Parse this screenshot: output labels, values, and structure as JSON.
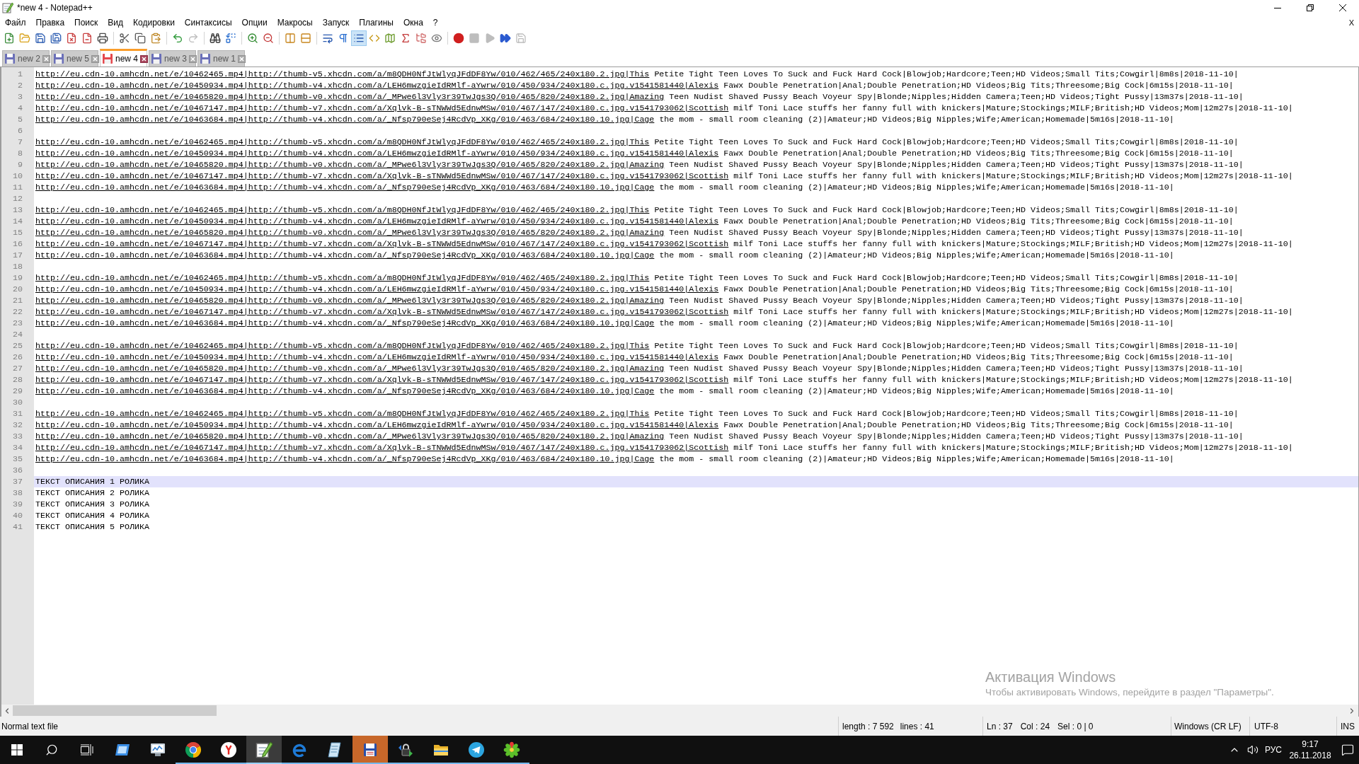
{
  "window": {
    "title": "*new 4 - Notepad++"
  },
  "menu": {
    "items": [
      "Файл",
      "Правка",
      "Поиск",
      "Вид",
      "Кодировки",
      "Синтаксисы",
      "Опции",
      "Макросы",
      "Запуск",
      "Плагины",
      "Окна",
      "?"
    ],
    "close": "X"
  },
  "toolbar": [
    {
      "kind": "new",
      "disabled": false,
      "pressed": false
    },
    {
      "kind": "open",
      "disabled": false,
      "pressed": false
    },
    {
      "kind": "save",
      "disabled": false,
      "pressed": false
    },
    {
      "kind": "save_all",
      "disabled": false,
      "pressed": false
    },
    {
      "kind": "close",
      "disabled": false,
      "pressed": false
    },
    {
      "kind": "close_all",
      "disabled": false,
      "pressed": false
    },
    {
      "kind": "print",
      "disabled": false,
      "pressed": false
    },
    {
      "kind": "separator"
    },
    {
      "kind": "cut",
      "disabled": false,
      "pressed": false
    },
    {
      "kind": "copy",
      "disabled": false,
      "pressed": false
    },
    {
      "kind": "paste",
      "disabled": false,
      "pressed": false
    },
    {
      "kind": "separator"
    },
    {
      "kind": "undo",
      "disabled": false,
      "pressed": false
    },
    {
      "kind": "redo",
      "disabled": true,
      "pressed": false
    },
    {
      "kind": "separator"
    },
    {
      "kind": "find",
      "disabled": false,
      "pressed": false
    },
    {
      "kind": "replace",
      "disabled": false,
      "pressed": false
    },
    {
      "kind": "separator"
    },
    {
      "kind": "zoom_in",
      "disabled": false,
      "pressed": false
    },
    {
      "kind": "zoom_out",
      "disabled": false,
      "pressed": false
    },
    {
      "kind": "separator"
    },
    {
      "kind": "sync_vertical",
      "disabled": false,
      "pressed": false
    },
    {
      "kind": "sync_horizontal",
      "disabled": false,
      "pressed": false
    },
    {
      "kind": "separator"
    },
    {
      "kind": "word_wrap",
      "disabled": false,
      "pressed": false
    },
    {
      "kind": "all_chars",
      "disabled": false,
      "pressed": false
    },
    {
      "kind": "indent_guide",
      "disabled": false,
      "pressed": true
    },
    {
      "kind": "user_language",
      "disabled": false,
      "pressed": false
    },
    {
      "kind": "document_map",
      "disabled": false,
      "pressed": false
    },
    {
      "kind": "function_list",
      "disabled": false,
      "pressed": false
    },
    {
      "kind": "folder_workspace",
      "disabled": false,
      "pressed": false
    },
    {
      "kind": "monitoring",
      "disabled": false,
      "pressed": false
    },
    {
      "kind": "separator"
    },
    {
      "kind": "record",
      "disabled": false,
      "pressed": false
    },
    {
      "kind": "stop",
      "disabled": true,
      "pressed": false
    },
    {
      "kind": "play",
      "disabled": true,
      "pressed": false
    },
    {
      "kind": "play_multiple",
      "disabled": false,
      "pressed": false
    },
    {
      "kind": "save_macro",
      "disabled": true,
      "pressed": false
    }
  ],
  "tabs": [
    {
      "label": "new 2",
      "selected": false,
      "modified": false
    },
    {
      "label": "new 5",
      "selected": false,
      "modified": false
    },
    {
      "label": "new 4",
      "selected": true,
      "modified": true
    },
    {
      "label": "new 3",
      "selected": false,
      "modified": false
    },
    {
      "label": "new 1",
      "selected": false,
      "modified": false
    }
  ],
  "editor": {
    "lines": [
      {
        "number": "1",
        "link": "http://eu.cdn-10.amhcdn.net/e/10462465.mp4|http://thumb-v5.xhcdn.com/a/m8QDH0NfJtWlyqJFdDF8Yw/010/462/465/240x180.2.jpg|This",
        "text": "Petite Tight Teen Loves To Suck and Fuck Hard Cock|Blowjob;Hardcore;Teen;HD Videos;Small Tits;Cowgirl|8m8s|2018-11-10|",
        "current": false
      },
      {
        "number": "2",
        "link": "http://eu.cdn-10.amhcdn.net/e/10450934.mp4|http://thumb-v4.xhcdn.com/a/LEH6mwzgieIdRMlf-aYwrw/010/450/934/240x180.c.jpg.v1541581440|Alexis",
        "text": "Fawx Double Penetration|Anal;Double Penetration;HD Videos;Big Tits;Threesome;Big Cock|6m15s|2018-11-10|",
        "current": false
      },
      {
        "number": "3",
        "link": "http://eu.cdn-10.amhcdn.net/e/10465820.mp4|http://thumb-v0.xhcdn.com/a/_MPwe6l3Vly3r39TwJgs3Q/010/465/820/240x180.2.jpg|Amazing",
        "text": "Teen Nudist Shaved Pussy Beach Voyeur Spy|Blonde;Nipples;Hidden Camera;Teen;HD Videos;Tight Pussy|13m37s|2018-11-10|",
        "current": false
      },
      {
        "number": "4",
        "link": "http://eu.cdn-10.amhcdn.net/e/10467147.mp4|http://thumb-v7.xhcdn.com/a/Xqlvk-B-sTNWWd5EdnwMSw/010/467/147/240x180.c.jpg.v1541793062|Scottish",
        "text": "milf Toni Lace stuffs her fanny full with knickers|Mature;Stockings;MILF;British;HD Videos;Mom|12m27s|2018-11-10|",
        "current": false
      },
      {
        "number": "5",
        "link": "http://eu.cdn-10.amhcdn.net/e/10463684.mp4|http://thumb-v4.xhcdn.com/a/_Nfsp790eSej4RcdVp_XKg/010/463/684/240x180.10.jpg|Cage",
        "text": "the mom - small room cleaning (2)|Amateur;HD Videos;Big Nipples;Wife;American;Homemade|5m16s|2018-11-10|",
        "current": false
      },
      {
        "number": "6",
        "current": false
      },
      {
        "number": "7",
        "link": "http://eu.cdn-10.amhcdn.net/e/10462465.mp4|http://thumb-v5.xhcdn.com/a/m8QDH0NfJtWlyqJFdDF8Yw/010/462/465/240x180.2.jpg|This",
        "text": "Petite Tight Teen Loves To Suck and Fuck Hard Cock|Blowjob;Hardcore;Teen;HD Videos;Small Tits;Cowgirl|8m8s|2018-11-10|",
        "current": false
      },
      {
        "number": "8",
        "link": "http://eu.cdn-10.amhcdn.net/e/10450934.mp4|http://thumb-v4.xhcdn.com/a/LEH6mwzgieIdRMlf-aYwrw/010/450/934/240x180.c.jpg.v1541581440|Alexis",
        "text": "Fawx Double Penetration|Anal;Double Penetration;HD Videos;Big Tits;Threesome;Big Cock|6m15s|2018-11-10|",
        "current": false
      },
      {
        "number": "9",
        "link": "http://eu.cdn-10.amhcdn.net/e/10465820.mp4|http://thumb-v0.xhcdn.com/a/_MPwe6l3Vly3r39TwJgs3Q/010/465/820/240x180.2.jpg|Amazing",
        "text": "Teen Nudist Shaved Pussy Beach Voyeur Spy|Blonde;Nipples;Hidden Camera;Teen;HD Videos;Tight Pussy|13m37s|2018-11-10|",
        "current": false
      },
      {
        "number": "10",
        "link": "http://eu.cdn-10.amhcdn.net/e/10467147.mp4|http://thumb-v7.xhcdn.com/a/Xqlvk-B-sTNWWd5EdnwMSw/010/467/147/240x180.c.jpg.v1541793062|Scottish",
        "text": "milf Toni Lace stuffs her fanny full with knickers|Mature;Stockings;MILF;British;HD Videos;Mom|12m27s|2018-11-10|",
        "current": false
      },
      {
        "number": "11",
        "link": "http://eu.cdn-10.amhcdn.net/e/10463684.mp4|http://thumb-v4.xhcdn.com/a/_Nfsp790eSej4RcdVp_XKg/010/463/684/240x180.10.jpg|Cage",
        "text": "the mom - small room cleaning (2)|Amateur;HD Videos;Big Nipples;Wife;American;Homemade|5m16s|2018-11-10|",
        "current": false
      },
      {
        "number": "12",
        "current": false
      },
      {
        "number": "13",
        "link": "http://eu.cdn-10.amhcdn.net/e/10462465.mp4|http://thumb-v5.xhcdn.com/a/m8QDH0NfJtWlyqJFdDF8Yw/010/462/465/240x180.2.jpg|This",
        "text": "Petite Tight Teen Loves To Suck and Fuck Hard Cock|Blowjob;Hardcore;Teen;HD Videos;Small Tits;Cowgirl|8m8s|2018-11-10|",
        "current": false
      },
      {
        "number": "14",
        "link": "http://eu.cdn-10.amhcdn.net/e/10450934.mp4|http://thumb-v4.xhcdn.com/a/LEH6mwzgieIdRMlf-aYwrw/010/450/934/240x180.c.jpg.v1541581440|Alexis",
        "text": "Fawx Double Penetration|Anal;Double Penetration;HD Videos;Big Tits;Threesome;Big Cock|6m15s|2018-11-10|",
        "current": false
      },
      {
        "number": "15",
        "link": "http://eu.cdn-10.amhcdn.net/e/10465820.mp4|http://thumb-v0.xhcdn.com/a/_MPwe6l3Vly3r39TwJgs3Q/010/465/820/240x180.2.jpg|Amazing",
        "text": "Teen Nudist Shaved Pussy Beach Voyeur Spy|Blonde;Nipples;Hidden Camera;Teen;HD Videos;Tight Pussy|13m37s|2018-11-10|",
        "current": false
      },
      {
        "number": "16",
        "link": "http://eu.cdn-10.amhcdn.net/e/10467147.mp4|http://thumb-v7.xhcdn.com/a/Xqlvk-B-sTNWWd5EdnwMSw/010/467/147/240x180.c.jpg.v1541793062|Scottish",
        "text": "milf Toni Lace stuffs her fanny full with knickers|Mature;Stockings;MILF;British;HD Videos;Mom|12m27s|2018-11-10|",
        "current": false
      },
      {
        "number": "17",
        "link": "http://eu.cdn-10.amhcdn.net/e/10463684.mp4|http://thumb-v4.xhcdn.com/a/_Nfsp790eSej4RcdVp_XKg/010/463/684/240x180.10.jpg|Cage",
        "text": "the mom - small room cleaning (2)|Amateur;HD Videos;Big Nipples;Wife;American;Homemade|5m16s|2018-11-10|",
        "current": false
      },
      {
        "number": "18",
        "current": false
      },
      {
        "number": "19",
        "link": "http://eu.cdn-10.amhcdn.net/e/10462465.mp4|http://thumb-v5.xhcdn.com/a/m8QDH0NfJtWlyqJFdDF8Yw/010/462/465/240x180.2.jpg|This",
        "text": "Petite Tight Teen Loves To Suck and Fuck Hard Cock|Blowjob;Hardcore;Teen;HD Videos;Small Tits;Cowgirl|8m8s|2018-11-10|",
        "current": false
      },
      {
        "number": "20",
        "link": "http://eu.cdn-10.amhcdn.net/e/10450934.mp4|http://thumb-v4.xhcdn.com/a/LEH6mwzgieIdRMlf-aYwrw/010/450/934/240x180.c.jpg.v1541581440|Alexis",
        "text": "Fawx Double Penetration|Anal;Double Penetration;HD Videos;Big Tits;Threesome;Big Cock|6m15s|2018-11-10|",
        "current": false
      },
      {
        "number": "21",
        "link": "http://eu.cdn-10.amhcdn.net/e/10465820.mp4|http://thumb-v0.xhcdn.com/a/_MPwe6l3Vly3r39TwJgs3Q/010/465/820/240x180.2.jpg|Amazing",
        "text": "Teen Nudist Shaved Pussy Beach Voyeur Spy|Blonde;Nipples;Hidden Camera;Teen;HD Videos;Tight Pussy|13m37s|2018-11-10|",
        "current": false
      },
      {
        "number": "22",
        "link": "http://eu.cdn-10.amhcdn.net/e/10467147.mp4|http://thumb-v7.xhcdn.com/a/Xqlvk-B-sTNWWd5EdnwMSw/010/467/147/240x180.c.jpg.v1541793062|Scottish",
        "text": "milf Toni Lace stuffs her fanny full with knickers|Mature;Stockings;MILF;British;HD Videos;Mom|12m27s|2018-11-10|",
        "current": false
      },
      {
        "number": "23",
        "link": "http://eu.cdn-10.amhcdn.net/e/10463684.mp4|http://thumb-v4.xhcdn.com/a/_Nfsp790eSej4RcdVp_XKg/010/463/684/240x180.10.jpg|Cage",
        "text": "the mom - small room cleaning (2)|Amateur;HD Videos;Big Nipples;Wife;American;Homemade|5m16s|2018-11-10|",
        "current": false
      },
      {
        "number": "24",
        "current": false
      },
      {
        "number": "25",
        "link": "http://eu.cdn-10.amhcdn.net/e/10462465.mp4|http://thumb-v5.xhcdn.com/a/m8QDH0NfJtWlyqJFdDF8Yw/010/462/465/240x180.2.jpg|This",
        "text": "Petite Tight Teen Loves To Suck and Fuck Hard Cock|Blowjob;Hardcore;Teen;HD Videos;Small Tits;Cowgirl|8m8s|2018-11-10|",
        "current": false
      },
      {
        "number": "26",
        "link": "http://eu.cdn-10.amhcdn.net/e/10450934.mp4|http://thumb-v4.xhcdn.com/a/LEH6mwzgieIdRMlf-aYwrw/010/450/934/240x180.c.jpg.v1541581440|Alexis",
        "text": "Fawx Double Penetration|Anal;Double Penetration;HD Videos;Big Tits;Threesome;Big Cock|6m15s|2018-11-10|",
        "current": false
      },
      {
        "number": "27",
        "link": "http://eu.cdn-10.amhcdn.net/e/10465820.mp4|http://thumb-v0.xhcdn.com/a/_MPwe6l3Vly3r39TwJgs3Q/010/465/820/240x180.2.jpg|Amazing",
        "text": "Teen Nudist Shaved Pussy Beach Voyeur Spy|Blonde;Nipples;Hidden Camera;Teen;HD Videos;Tight Pussy|13m37s|2018-11-10|",
        "current": false
      },
      {
        "number": "28",
        "link": "http://eu.cdn-10.amhcdn.net/e/10467147.mp4|http://thumb-v7.xhcdn.com/a/Xqlvk-B-sTNWWd5EdnwMSw/010/467/147/240x180.c.jpg.v1541793062|Scottish",
        "text": "milf Toni Lace stuffs her fanny full with knickers|Mature;Stockings;MILF;British;HD Videos;Mom|12m27s|2018-11-10|",
        "current": false
      },
      {
        "number": "29",
        "link": "http://eu.cdn-10.amhcdn.net/e/10463684.mp4|http://thumb-v4.xhcdn.com/a/_Nfsp790eSej4RcdVp_XKg/010/463/684/240x180.10.jpg|Cage",
        "text": "the mom - small room cleaning (2)|Amateur;HD Videos;Big Nipples;Wife;American;Homemade|5m16s|2018-11-10|",
        "current": false
      },
      {
        "number": "30",
        "current": false
      },
      {
        "number": "31",
        "link": "http://eu.cdn-10.amhcdn.net/e/10462465.mp4|http://thumb-v5.xhcdn.com/a/m8QDH0NfJtWlyqJFdDF8Yw/010/462/465/240x180.2.jpg|This",
        "text": "Petite Tight Teen Loves To Suck and Fuck Hard Cock|Blowjob;Hardcore;Teen;HD Videos;Small Tits;Cowgirl|8m8s|2018-11-10|",
        "current": false
      },
      {
        "number": "32",
        "link": "http://eu.cdn-10.amhcdn.net/e/10450934.mp4|http://thumb-v4.xhcdn.com/a/LEH6mwzgieIdRMlf-aYwrw/010/450/934/240x180.c.jpg.v1541581440|Alexis",
        "text": "Fawx Double Penetration|Anal;Double Penetration;HD Videos;Big Tits;Threesome;Big Cock|6m15s|2018-11-10|",
        "current": false
      },
      {
        "number": "33",
        "link": "http://eu.cdn-10.amhcdn.net/e/10465820.mp4|http://thumb-v0.xhcdn.com/a/_MPwe6l3Vly3r39TwJgs3Q/010/465/820/240x180.2.jpg|Amazing",
        "text": "Teen Nudist Shaved Pussy Beach Voyeur Spy|Blonde;Nipples;Hidden Camera;Teen;HD Videos;Tight Pussy|13m37s|2018-11-10|",
        "current": false
      },
      {
        "number": "34",
        "link": "http://eu.cdn-10.amhcdn.net/e/10467147.mp4|http://thumb-v7.xhcdn.com/a/Xqlvk-B-sTNWWd5EdnwMSw/010/467/147/240x180.c.jpg.v1541793062|Scottish",
        "text": "milf Toni Lace stuffs her fanny full with knickers|Mature;Stockings;MILF;British;HD Videos;Mom|12m27s|2018-11-10|",
        "current": false
      },
      {
        "number": "35",
        "link": "http://eu.cdn-10.amhcdn.net/e/10463684.mp4|http://thumb-v4.xhcdn.com/a/_Nfsp790eSej4RcdVp_XKg/010/463/684/240x180.10.jpg|Cage",
        "text": "the mom - small room cleaning (2)|Amateur;HD Videos;Big Nipples;Wife;American;Homemade|5m16s|2018-11-10|",
        "current": false
      },
      {
        "number": "36",
        "current": false
      },
      {
        "number": "37",
        "text": "ТЕКСТ ОПИСАНИЯ 1 РОЛИКА",
        "current": true
      },
      {
        "number": "38",
        "text": "ТЕКСТ ОПИСАНИЯ 2 РОЛИКА",
        "current": false
      },
      {
        "number": "39",
        "text": "ТЕКСТ ОПИСАНИЯ 3 РОЛИКА",
        "current": false
      },
      {
        "number": "40",
        "text": "ТЕКСТ ОПИСАНИЯ 4 РОЛИКА",
        "current": false
      },
      {
        "number": "41",
        "text": "ТЕКСТ ОПИСАНИЯ 5 РОЛИКА",
        "current": false
      }
    ]
  },
  "activation_notice": {
    "title": "Активация Windows",
    "text": "Чтобы активировать Windows, перейдите в раздел \"Параметры\"."
  },
  "status_bar": {
    "file_type": "Normal text file",
    "length": "length : 7 592",
    "lines": "lines : 41",
    "line": "Ln : 37",
    "column": "Col : 24",
    "selection": "Sel : 0 | 0",
    "eol": "Windows (CR LF)",
    "encoding": "UTF-8",
    "mode": "INS"
  },
  "taskbar": {
    "apps": [
      {
        "running": false,
        "active": false,
        "attention": false
      },
      {
        "running": false,
        "active": false,
        "attention": false
      },
      {
        "running": true,
        "active": false,
        "attention": false
      },
      {
        "running": true,
        "active": false,
        "attention": false
      },
      {
        "running": true,
        "active": true,
        "attention": false
      },
      {
        "running": true,
        "active": false,
        "attention": false
      },
      {
        "running": true,
        "active": false,
        "attention": false
      },
      {
        "running": true,
        "active": false,
        "attention": true
      },
      {
        "running": true,
        "active": false,
        "attention": false
      },
      {
        "running": true,
        "active": false,
        "attention": false
      },
      {
        "running": true,
        "active": false,
        "attention": false
      },
      {
        "running": true,
        "active": false,
        "attention": false
      }
    ],
    "tray": {
      "language": "РУС",
      "time": "9:17",
      "date": "26.11.2018"
    }
  }
}
